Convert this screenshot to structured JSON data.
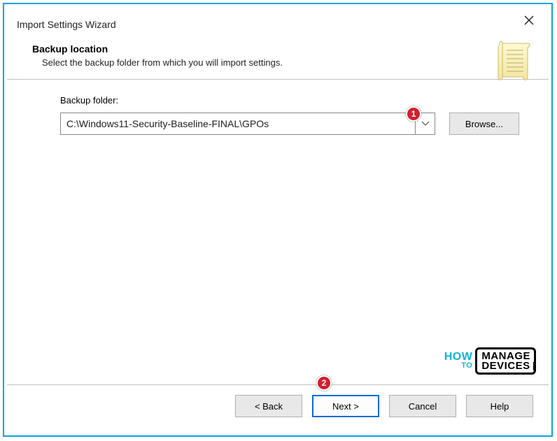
{
  "window": {
    "title": "Import Settings Wizard"
  },
  "header": {
    "heading": "Backup location",
    "subtext": "Select the backup folder from which you will import settings."
  },
  "form": {
    "folder_label": "Backup folder:",
    "folder_value": "C:\\Windows11-Security-Baseline-FINAL\\GPOs",
    "browse_label": "Browse..."
  },
  "buttons": {
    "back": "< Back",
    "next": "Next >",
    "cancel": "Cancel",
    "help": "Help"
  },
  "markers": {
    "one": "1",
    "two": "2"
  },
  "watermark": {
    "how": "HOW",
    "to": "TO",
    "line1": "MANAGE",
    "line2": "DEVICES"
  }
}
